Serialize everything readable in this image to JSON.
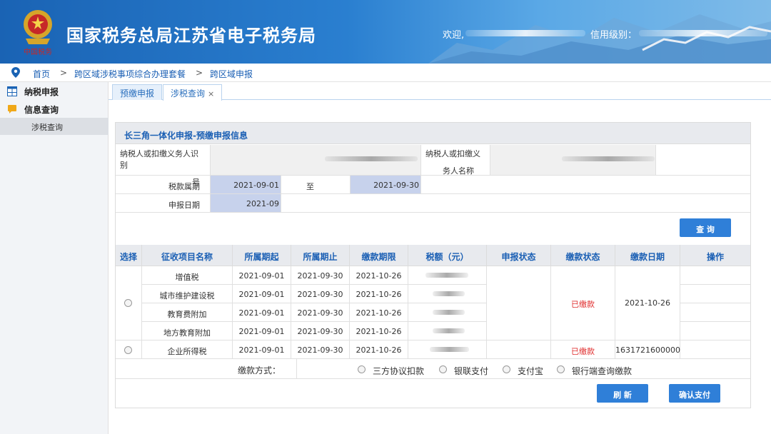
{
  "header": {
    "title": "国家税务总局江苏省电子税务局",
    "welcome_label": "欢迎,",
    "credit_label": "信用级别："
  },
  "breadcrumb": [
    "首页",
    "跨区域涉税事项综合办理套餐",
    "跨区域申报"
  ],
  "breadcrumb_sep": ">",
  "sidebar": {
    "items": [
      {
        "label": "纳税申报",
        "icon": "table-icon"
      },
      {
        "label": "信息查询",
        "icon": "chat-icon"
      }
    ],
    "sub_item": "涉税查询"
  },
  "tabs": [
    {
      "label": "预缴申报"
    },
    {
      "label": "涉税查询",
      "close": "×"
    }
  ],
  "panel": {
    "title": "长三角一体化申报-预缴申报信息",
    "taxpayer_id_label_1": "纳税人或扣缴义务人识别",
    "taxpayer_id_label_2": "号",
    "taxpayer_name_label_1": "纳税人或扣缴义",
    "taxpayer_name_label_2": "务人名称",
    "tax_period_label": "税款属期",
    "period_start": "2021-09-01",
    "period_to": "至",
    "period_end": "2021-09-30",
    "declare_date_label": "申报日期",
    "declare_date": "2021-09",
    "query_button": "查 询"
  },
  "table": {
    "headers": [
      "选择",
      "征收项目名称",
      "所属期起",
      "所属期止",
      "缴款期限",
      "税额（元）",
      "申报状态",
      "缴款状态",
      "缴款日期",
      "操作"
    ],
    "group1_rows": [
      {
        "name": "增值税",
        "start": "2021-09-01",
        "end": "2021-09-30",
        "deadline": "2021-10-26"
      },
      {
        "name": "城市维护建设税",
        "start": "2021-09-01",
        "end": "2021-09-30",
        "deadline": "2021-10-26"
      },
      {
        "name": "教育费附加",
        "start": "2021-09-01",
        "end": "2021-09-30",
        "deadline": "2021-10-26"
      },
      {
        "name": "地方教育附加",
        "start": "2021-09-01",
        "end": "2021-09-30",
        "deadline": "2021-10-26"
      }
    ],
    "group1_pay_status": "已缴款",
    "group1_pay_date": "2021-10-26",
    "row5": {
      "name": "企业所得税",
      "start": "2021-09-01",
      "end": "2021-09-30",
      "deadline": "2021-10-26",
      "pay_status": "已缴款",
      "pay_date": "1631721600000"
    }
  },
  "payment": {
    "label": "缴款方式：",
    "options": [
      "三方协议扣款",
      "银联支付",
      "支付宝",
      "银行端查询缴款"
    ]
  },
  "buttons": {
    "refresh": "刷 新",
    "confirm_pay": "确认支付"
  },
  "colors": {
    "header_blue": "#1a63b4",
    "accent": "#2f7fd8",
    "paid_red": "#e03030"
  }
}
